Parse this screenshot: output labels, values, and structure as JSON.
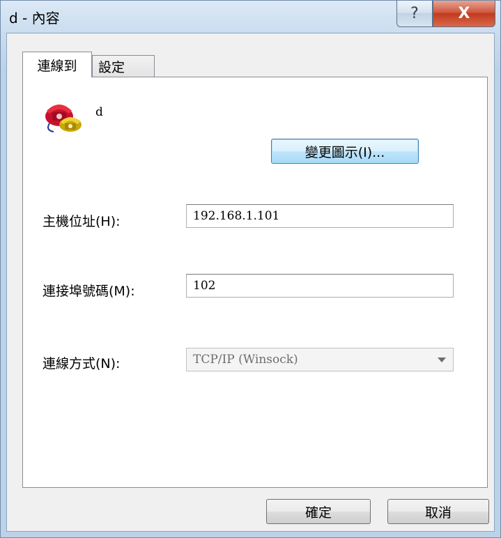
{
  "window": {
    "title": "d - 內容",
    "help_label": "?",
    "close_label": "X"
  },
  "tabs": [
    {
      "label": "連線到",
      "active": true
    },
    {
      "label": "設定",
      "active": false
    }
  ],
  "connection": {
    "icon": "phone-icon",
    "name": "d",
    "change_icon_label": "變更圖示(I)..."
  },
  "fields": {
    "host_label": "主機位址(H):",
    "host_value": "192.168.1.101",
    "port_label": "連接埠號碼(M):",
    "port_value": "102",
    "method_label": "連線方式(N):",
    "method_value": "TCP/IP (Winsock)"
  },
  "buttons": {
    "ok_label": "確定",
    "cancel_label": "取消"
  },
  "colors": {
    "title_gradient": "#c9dcee",
    "close_red": "#c23a1f",
    "focus_blue": "#3c7fb1"
  }
}
